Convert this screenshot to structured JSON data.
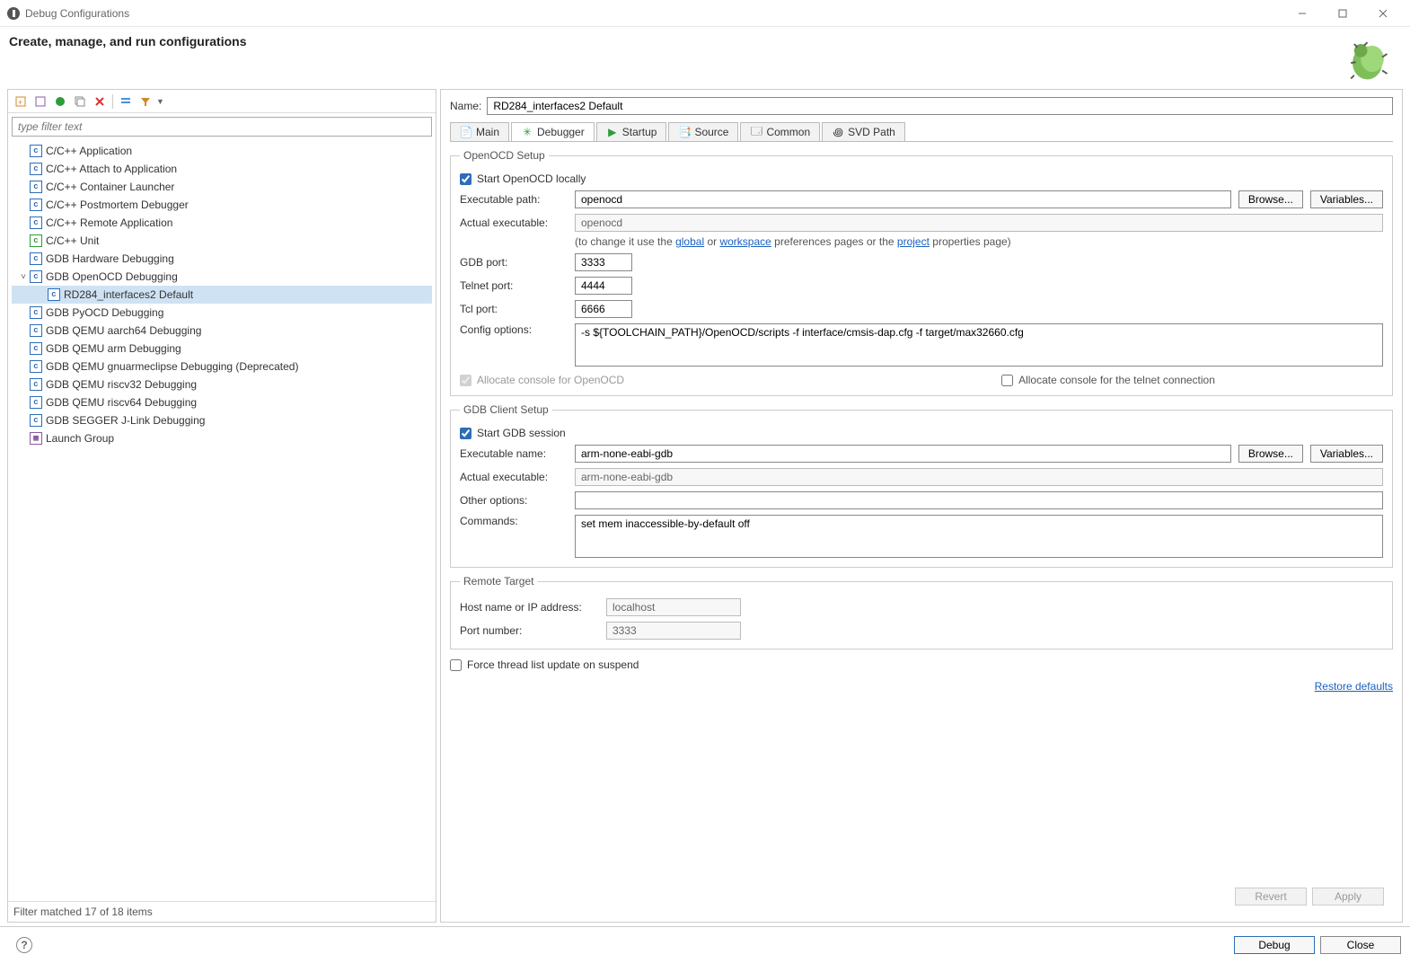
{
  "window": {
    "title": "Debug Configurations"
  },
  "header": {
    "heading": "Create, manage, and run configurations"
  },
  "left": {
    "filter_placeholder": "type filter text",
    "items": [
      {
        "label": "C/C++ Application"
      },
      {
        "label": "C/C++ Attach to Application"
      },
      {
        "label": "C/C++ Container Launcher"
      },
      {
        "label": "C/C++ Postmortem Debugger"
      },
      {
        "label": "C/C++ Remote Application"
      },
      {
        "label": "C/C++ Unit",
        "variant": "green"
      },
      {
        "label": "GDB Hardware Debugging"
      },
      {
        "label": "GDB OpenOCD Debugging",
        "expanded": true,
        "children": [
          {
            "label": "RD284_interfaces2 Default",
            "selected": true
          }
        ]
      },
      {
        "label": "GDB PyOCD Debugging"
      },
      {
        "label": "GDB QEMU aarch64 Debugging"
      },
      {
        "label": "GDB QEMU arm Debugging"
      },
      {
        "label": "GDB QEMU gnuarmeclipse Debugging (Deprecated)"
      },
      {
        "label": "GDB QEMU riscv32 Debugging"
      },
      {
        "label": "GDB QEMU riscv64 Debugging"
      },
      {
        "label": "GDB SEGGER J-Link Debugging"
      },
      {
        "label": "Launch Group",
        "variant": "purple"
      }
    ],
    "status": "Filter matched 17 of 18 items"
  },
  "right": {
    "name_label": "Name:",
    "name_value": "RD284_interfaces2 Default",
    "tabs": [
      "Main",
      "Debugger",
      "Startup",
      "Source",
      "Common",
      "SVD Path"
    ],
    "openocd": {
      "legend": "OpenOCD Setup",
      "start_locally": "Start OpenOCD locally",
      "exec_path_label": "Executable path:",
      "exec_path": "openocd",
      "actual_exec_label": "Actual executable:",
      "actual_exec": "openocd",
      "hint_prefix": "(to change it use the ",
      "hint_global": "global",
      "hint_or": " or ",
      "hint_workspace": "workspace",
      "hint_mid": " preferences pages or the ",
      "hint_project": "project",
      "hint_suffix": " properties page)",
      "gdb_port_label": "GDB port:",
      "gdb_port": "3333",
      "telnet_port_label": "Telnet port:",
      "telnet_port": "4444",
      "tcl_port_label": "Tcl port:",
      "tcl_port": "6666",
      "config_label": "Config options:",
      "config_value": "-s ${TOOLCHAIN_PATH}/OpenOCD/scripts -f interface/cmsis-dap.cfg -f target/max32660.cfg",
      "allocate_openocd": "Allocate console for OpenOCD",
      "allocate_telnet": "Allocate console for the telnet connection"
    },
    "gdb": {
      "legend": "GDB Client Setup",
      "start_session": "Start GDB session",
      "exec_name_label": "Executable name:",
      "exec_name": "arm-none-eabi-gdb",
      "actual_exec_label": "Actual executable:",
      "actual_exec": "arm-none-eabi-gdb",
      "other_label": "Other options:",
      "other_value": "",
      "commands_label": "Commands:",
      "commands_value": "set mem inaccessible-by-default off"
    },
    "remote": {
      "legend": "Remote Target",
      "host_label": "Host name or IP address:",
      "host_value": "localhost",
      "port_label": "Port number:",
      "port_value": "3333"
    },
    "force_update": "Force thread list update on suspend",
    "restore_defaults": "Restore defaults",
    "browse": "Browse...",
    "variables": "Variables...",
    "revert": "Revert",
    "apply": "Apply"
  },
  "footer": {
    "debug": "Debug",
    "close": "Close"
  }
}
